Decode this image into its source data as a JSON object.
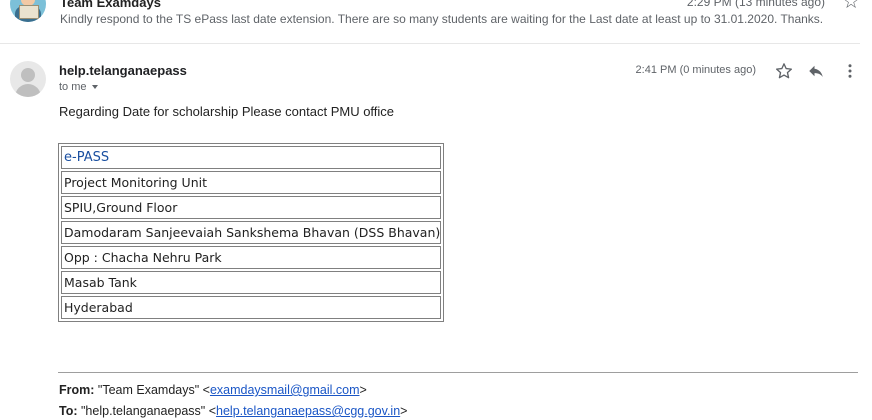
{
  "previous_message": {
    "sender": "Team Examdays",
    "time": "2:29 PM (13 minutes ago)",
    "snippet": "Kindly respond to the TS ePass last date extension. There are so many students are waiting for the Last date at least up to 31.01.2020. Thanks."
  },
  "message": {
    "sender": "help.telanganaepass",
    "recipient_label": "to me",
    "time": "2:41 PM (0 minutes ago)",
    "body": "Regarding Date for scholarship Please contact PMU office",
    "contact_rows": [
      "e-PASS",
      "Project Monitoring Unit",
      "SPIU,Ground Floor",
      "Damodaram Sanjeevaiah Sankshema Bhavan (DSS Bhavan)",
      "Opp : Chacha Nehru Park",
      "Masab Tank",
      "Hyderabad"
    ],
    "quoted": {
      "from_label": "From:",
      "from_name": "\"Team Examdays\" <",
      "from_email": "examdaysmail@gmail.com",
      "from_close": ">",
      "to_label": "To:",
      "to_name": "\"help.telanganaepass\" <",
      "to_email": "help.telanganaepass@cgg.gov.in",
      "to_close": ">"
    }
  },
  "icons": {
    "star": "star-icon",
    "reply": "reply-icon",
    "more": "more-vert-icon"
  },
  "colors": {
    "link": "#1a56c6",
    "brand_text": "#1a4fa0",
    "secondary_text": "#5f6368"
  }
}
